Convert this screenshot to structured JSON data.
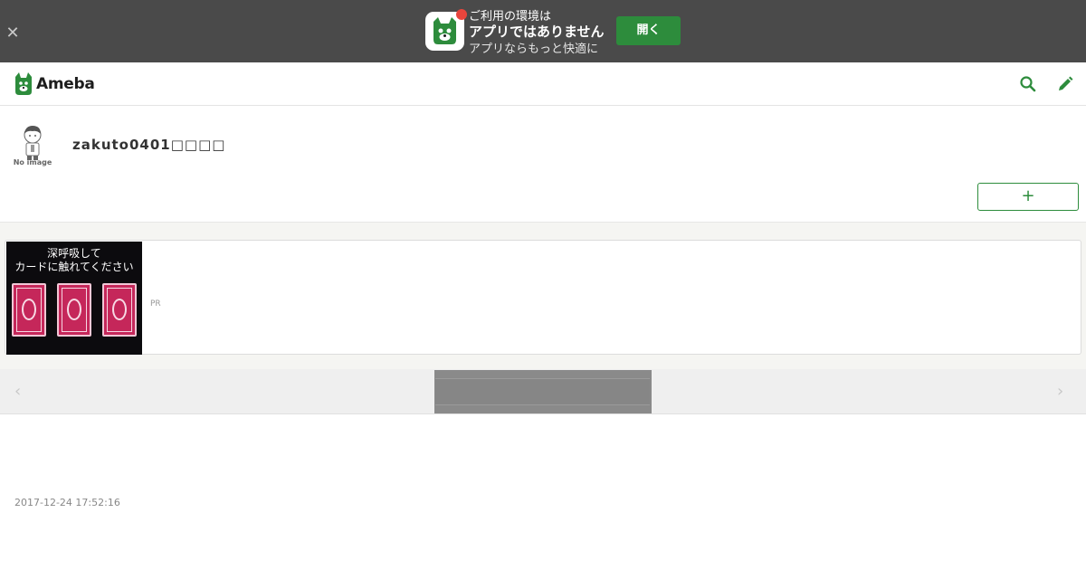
{
  "app_banner": {
    "line1": "ご利用の環境は",
    "line2": "アプリではありません",
    "line3": "アプリならもっと快適に",
    "open_label": "開く",
    "close_icon": "close-icon",
    "accent": "#2d8c3c",
    "badge_color": "#e8453c"
  },
  "header": {
    "logo_text": "Ameba",
    "search_icon": "search-icon",
    "edit_icon": "pencil-icon"
  },
  "profile": {
    "avatar_caption": "No image",
    "blog_title": "zakuto0401□□□□",
    "follow_label": "+"
  },
  "ad": {
    "image_line1": "深呼吸して",
    "image_line2": "カードに触れてください",
    "pr_label": "PR"
  },
  "pager": {
    "prev_icon": "chevron-left-icon",
    "next_icon": "chevron-right-icon"
  },
  "post": {
    "timestamp": "2017-12-24 17:52:16"
  }
}
